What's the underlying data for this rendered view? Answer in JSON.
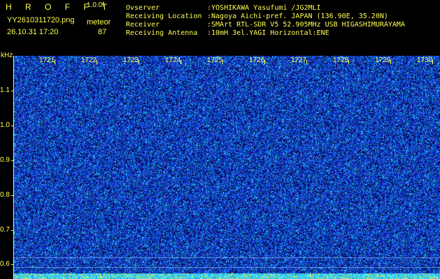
{
  "header": {
    "app_name": "H R O F F T",
    "version": "1.0.0f",
    "filename": "YY2610311720.png",
    "mode": "meteor",
    "datetime": "26.10.31 17:20",
    "count": "87"
  },
  "station": [
    {
      "label": "Ovserver",
      "value": ":YOSHIKAWA Yasufumi /JG2MLI"
    },
    {
      "label": "Receiving Location",
      "value": ":Nagoya Aichi-pref. JAPAN (136.90E, 35.20N)"
    },
    {
      "label": "Receiver",
      "value": ":SMArt RTL-SDR V5 52.905MHz USB HIGASHIMURAYAMA"
    },
    {
      "label": "Receiving Antenna",
      "value": ":10mH 3el.YAGI Horizontal:ENE"
    }
  ],
  "axis": {
    "unit": "kHz",
    "y_ticks": [
      "1.1",
      "1.0",
      "0.9",
      "0.8",
      "0.7",
      "0.6"
    ],
    "time_ticks": [
      "1721",
      "1722",
      "1723",
      "1724",
      "1725",
      "1726",
      "1727",
      "1728",
      "1729",
      "1730"
    ]
  },
  "colors": {
    "text": "#ffff55",
    "background": "#000000",
    "waterfall_base": "#1a2ad0",
    "noise_bright": "#00e5ff",
    "band_bottom": "#33e6ff"
  }
}
